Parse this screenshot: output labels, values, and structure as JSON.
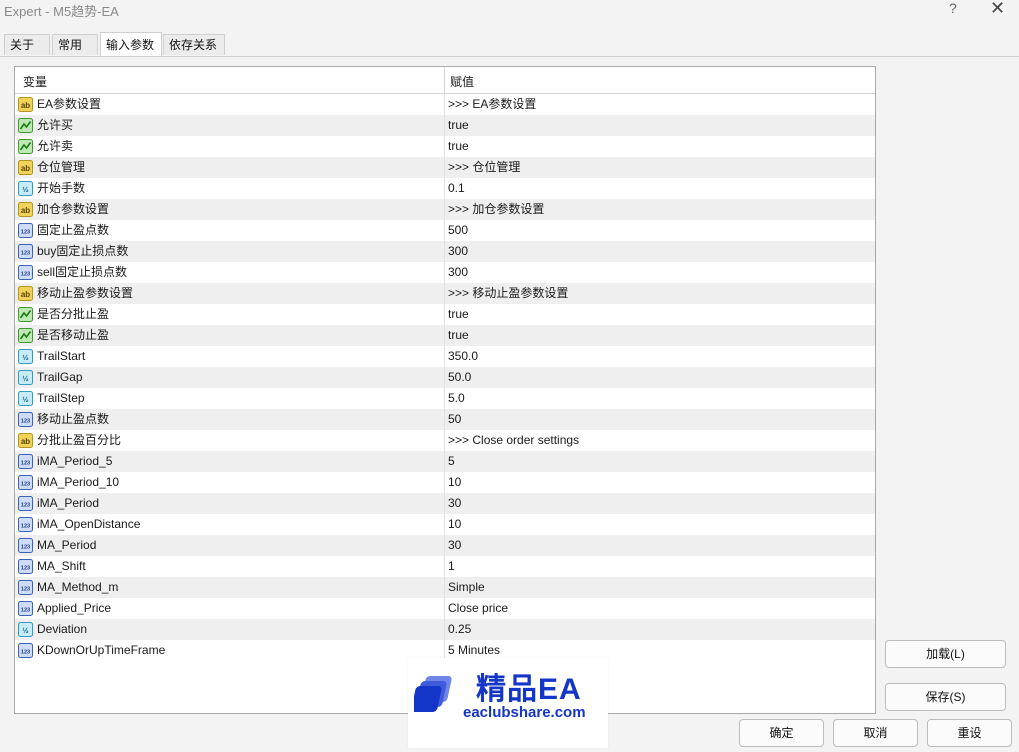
{
  "window": {
    "title": "Expert - M5趋势-EA",
    "help": "?",
    "close": "✕"
  },
  "tabs": [
    {
      "label": "关于",
      "active": false
    },
    {
      "label": "常用",
      "active": false
    },
    {
      "label": "输入参数",
      "active": true
    },
    {
      "label": "依存关系",
      "active": false
    }
  ],
  "table": {
    "headers": [
      "变量",
      "赋值"
    ],
    "rows": [
      {
        "icon": "string-ab-icon",
        "name": "EA参数设置",
        "value": ">>> EA参数设置"
      },
      {
        "icon": "bool-icon",
        "name": "允许买",
        "value": "true"
      },
      {
        "icon": "bool-icon",
        "name": "允许卖",
        "value": "true"
      },
      {
        "icon": "string-ab-icon",
        "name": "仓位管理",
        "value": ">>> 仓位管理"
      },
      {
        "icon": "double-icon",
        "name": "开始手数",
        "value": "0.1"
      },
      {
        "icon": "string-ab-icon",
        "name": "加仓参数设置",
        "value": ">>> 加仓参数设置"
      },
      {
        "icon": "int-icon",
        "name": "固定止盈点数",
        "value": "500"
      },
      {
        "icon": "int-icon",
        "name": "buy固定止损点数",
        "value": "300"
      },
      {
        "icon": "int-icon",
        "name": "sell固定止损点数",
        "value": "300"
      },
      {
        "icon": "string-ab-icon",
        "name": "移动止盈参数设置",
        "value": ">>> 移动止盈参数设置"
      },
      {
        "icon": "bool-icon",
        "name": "是否分批止盈",
        "value": "true"
      },
      {
        "icon": "bool-icon",
        "name": "是否移动止盈",
        "value": "true"
      },
      {
        "icon": "double-icon",
        "name": "TrailStart",
        "value": "350.0"
      },
      {
        "icon": "double-icon",
        "name": "TrailGap",
        "value": "50.0"
      },
      {
        "icon": "double-icon",
        "name": "TrailStep",
        "value": "5.0"
      },
      {
        "icon": "int-icon",
        "name": "移动止盈点数",
        "value": "50"
      },
      {
        "icon": "string-ab-icon",
        "name": "分批止盈百分比",
        "value": ">>> Close order settings"
      },
      {
        "icon": "int-icon",
        "name": "iMA_Period_5",
        "value": "5"
      },
      {
        "icon": "int-icon",
        "name": "iMA_Period_10",
        "value": "10"
      },
      {
        "icon": "int-icon",
        "name": "iMA_Period",
        "value": "30"
      },
      {
        "icon": "int-icon",
        "name": "iMA_OpenDistance",
        "value": "10"
      },
      {
        "icon": "int-icon",
        "name": "MA_Period",
        "value": "30"
      },
      {
        "icon": "int-icon",
        "name": "MA_Shift",
        "value": "1"
      },
      {
        "icon": "int-icon",
        "name": "MA_Method_m",
        "value": "Simple"
      },
      {
        "icon": "int-icon",
        "name": "Applied_Price",
        "value": "Close price"
      },
      {
        "icon": "double-icon",
        "name": "Deviation",
        "value": "0.25"
      },
      {
        "icon": "int-icon",
        "name": "KDownOrUpTimeFrame",
        "value": "5 Minutes"
      }
    ]
  },
  "buttons": {
    "load": "加载(L)",
    "save": "保存(S)",
    "ok": "确定",
    "cancel": "取消",
    "reset": "重设"
  },
  "watermark": {
    "brand": "精品EA",
    "url": "eaclubshare.com"
  },
  "colors": {
    "accent": "#1436c8",
    "alt_row": "#efefef"
  }
}
